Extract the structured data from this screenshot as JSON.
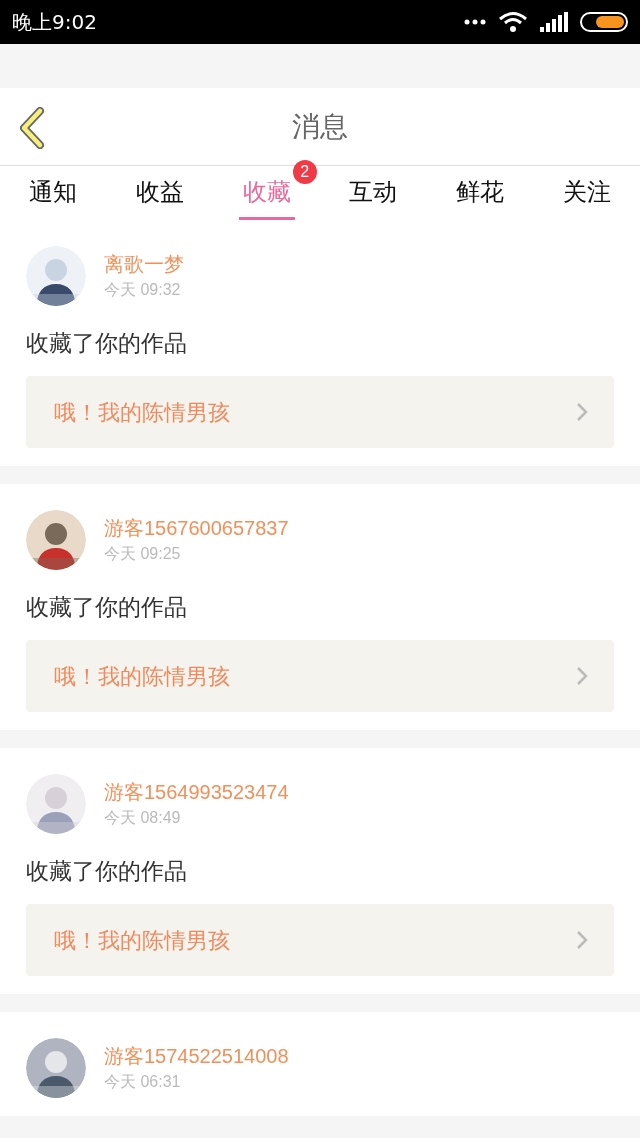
{
  "status_bar": {
    "time": "晚上9:02"
  },
  "header": {
    "title": "消息"
  },
  "tabs": [
    {
      "label": "通知",
      "selected": false
    },
    {
      "label": "收益",
      "selected": false
    },
    {
      "label": "收藏",
      "selected": true,
      "badge": "2"
    },
    {
      "label": "互动",
      "selected": false
    },
    {
      "label": "鲜花",
      "selected": false
    },
    {
      "label": "关注",
      "selected": false
    }
  ],
  "messages": [
    {
      "user": "离歌一梦",
      "time": "今天 09:32",
      "text": "收藏了你的作品",
      "work": "哦！我的陈情男孩"
    },
    {
      "user": "游客1567600657837",
      "time": "今天 09:25",
      "text": "收藏了你的作品",
      "work": "哦！我的陈情男孩"
    },
    {
      "user": "游客1564993523474",
      "time": "今天 08:49",
      "text": "收藏了你的作品",
      "work": "哦！我的陈情男孩"
    },
    {
      "user": "游客1574522514008",
      "time": "今天 06:31"
    }
  ]
}
